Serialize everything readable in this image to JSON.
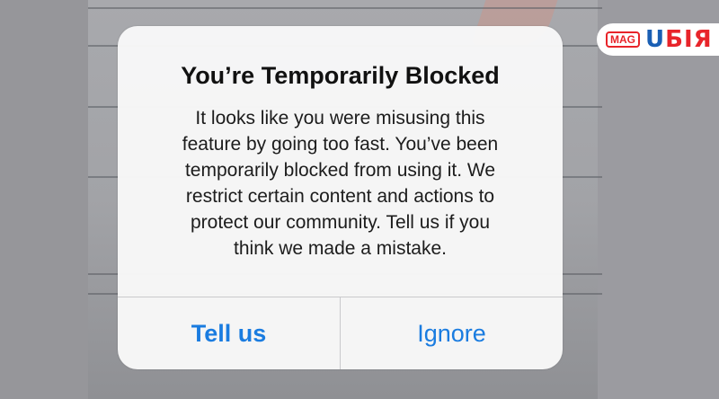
{
  "logo": {
    "badge": "MAG",
    "word_part1": "U",
    "word_part2": "БIЯ"
  },
  "alert": {
    "title": "You’re Temporarily Blocked",
    "message_lines": [
      "It looks like you were misusing this",
      "feature by going too fast. You’ve been",
      "temporarily blocked from using it. We",
      "restrict certain content and actions to",
      "protect our community. Tell us if you",
      "think we made a mistake."
    ],
    "buttons": {
      "tell_us": "Tell us",
      "ignore": "Ignore"
    }
  },
  "colors": {
    "button_text": "#1a7ce0",
    "logo_blue": "#1a5fb4",
    "logo_red": "#e8242a"
  }
}
